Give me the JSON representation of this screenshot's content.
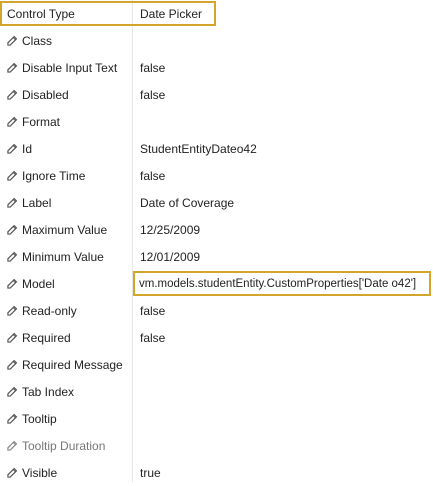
{
  "header": {
    "name": "Control Type",
    "value": "Date Picker"
  },
  "properties": [
    {
      "name": "Class",
      "value": ""
    },
    {
      "name": "Disable Input Text",
      "value": "false"
    },
    {
      "name": "Disabled",
      "value": "false"
    },
    {
      "name": "Format",
      "value": ""
    },
    {
      "name": "Id",
      "value": "StudentEntityDateo42"
    },
    {
      "name": "Ignore Time",
      "value": "false"
    },
    {
      "name": "Label",
      "value": "Date of Coverage"
    },
    {
      "name": "Maximum Value",
      "value": "12/25/2009"
    },
    {
      "name": "Minimum Value",
      "value": "12/01/2009"
    },
    {
      "name": "Model",
      "value": "vm.models.studentEntity.CustomProperties['Date o42']"
    },
    {
      "name": "Read-only",
      "value": "false"
    },
    {
      "name": "Required",
      "value": "false"
    },
    {
      "name": "Required Message",
      "value": ""
    },
    {
      "name": "Tab Index",
      "value": ""
    },
    {
      "name": "Tooltip",
      "value": ""
    },
    {
      "name": "Tooltip Duration",
      "value": ""
    },
    {
      "name": "Visible",
      "value": "true"
    }
  ],
  "icon": "edit-icon",
  "colors": {
    "highlight": "#d3a52b",
    "icon": "#555555",
    "divider": "#e6e6e6"
  }
}
